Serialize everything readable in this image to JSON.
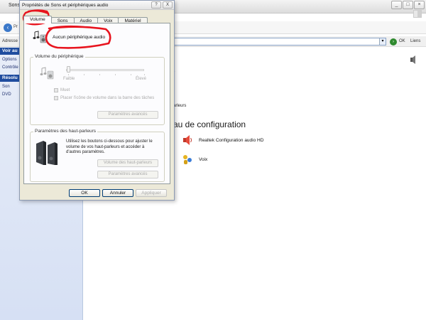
{
  "background_window": {
    "title": "Sons",
    "back_label": "Pr",
    "address_label": "Adresse",
    "go_label": "OK",
    "links_label": "Liens",
    "sidebar": {
      "section1_header": "Voir au",
      "section1_items": [
        "Options",
        "Contrôle"
      ],
      "section2_header": "Résolu",
      "section2_items": [
        "Son",
        "DVD"
      ]
    },
    "main": {
      "frag_dot": ".",
      "frag_parleurs": "arleurs",
      "heading": "au de configuration",
      "items": [
        {
          "label": "Realtek Configuration audio HD",
          "icon": "realtek-speaker-icon"
        },
        {
          "label": "Voix",
          "icon": "voice-icon"
        }
      ]
    }
  },
  "dialog": {
    "title": "Propriétés de Sons et périphériques audio",
    "title_buttons": [
      "?",
      "X"
    ],
    "tabs": [
      "Volume",
      "Sons",
      "Audio",
      "Voix",
      "Matériel"
    ],
    "active_tab": "Volume",
    "device_name": "Aucun périphérique audio",
    "volume_group": {
      "label": "Volume du périphérique",
      "slider_min_label": "Faible",
      "slider_max_label": "Élevé",
      "mute_label": "Muet",
      "taskbar_label": "Placer l'icône de volume dans la barre des tâches",
      "advanced_button": "Paramètres avancés"
    },
    "speaker_group": {
      "label": "Paramètres des haut-parleurs",
      "description": "Utilisez les boutons ci-dessous pour ajuster le volume de vos haut-parleurs et accéder à d'autres paramètres.",
      "volume_button": "Volume des haut-parleurs",
      "advanced_button": "Paramètres avancés"
    },
    "ok_button": "OK",
    "cancel_button": "Annuler",
    "apply_button": "Appliquer"
  },
  "colors": {
    "annotation": "#e8141e",
    "sidebar_header": "#1f4c9f",
    "dialog_bg": "#ece9d8"
  }
}
